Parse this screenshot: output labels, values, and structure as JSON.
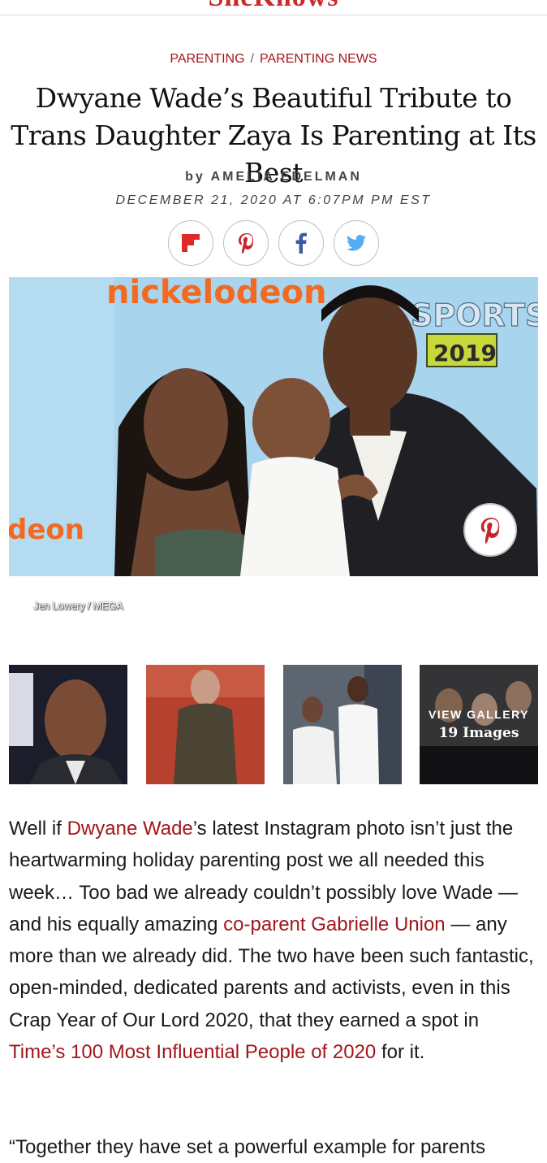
{
  "site": {
    "logo_text": "SheKnows"
  },
  "breadcrumb": {
    "items": [
      "PARENTING",
      "PARENTING NEWS"
    ],
    "separator": "/"
  },
  "article": {
    "headline": "Dwyane Wade’s Beautiful Tribute to Trans Daughter Zaya Is Parenting at Its Best",
    "byline_prefix": "by",
    "author": "AMELIA EDELMAN",
    "date": "DECEMBER 21, 2020 AT 6:07PM PM EST"
  },
  "share": {
    "buttons": [
      "flipboard-icon",
      "pinterest-icon",
      "facebook-icon",
      "twitter-icon"
    ]
  },
  "hero": {
    "backdrop_text_top": "nickelodeon",
    "backdrop_text_right": "SPORTS",
    "backdrop_text_year": "2019",
    "backdrop_text_left": "deon",
    "credit": "Jen Lowery / MEGA"
  },
  "gallery": {
    "label": "VIEW GALLERY",
    "count": "19 Images"
  },
  "body": {
    "p1": {
      "t1": "Well if ",
      "link1": "Dwyane Wade",
      "t2": "’s latest Instagram photo isn’t just the heartwarming holiday parenting post we all needed this week… Too bad we already couldn’t possibly love Wade — and his equally amazing ",
      "link2": "co-parent Gabrielle Union",
      "t3": " — any more than we already did. The two have been such fantastic, open-minded, dedicated parents and activists, even in this Crap Year of Our Lord 2020, that they earned a spot in ",
      "link3": "Time’s 100 Most Influential People of 2020",
      "t4": " for it."
    },
    "p2_partial": "“Together they have set a powerful example for parents"
  },
  "colors": {
    "accent": "#a3161c",
    "hero_bg": "#a9d4ee"
  }
}
